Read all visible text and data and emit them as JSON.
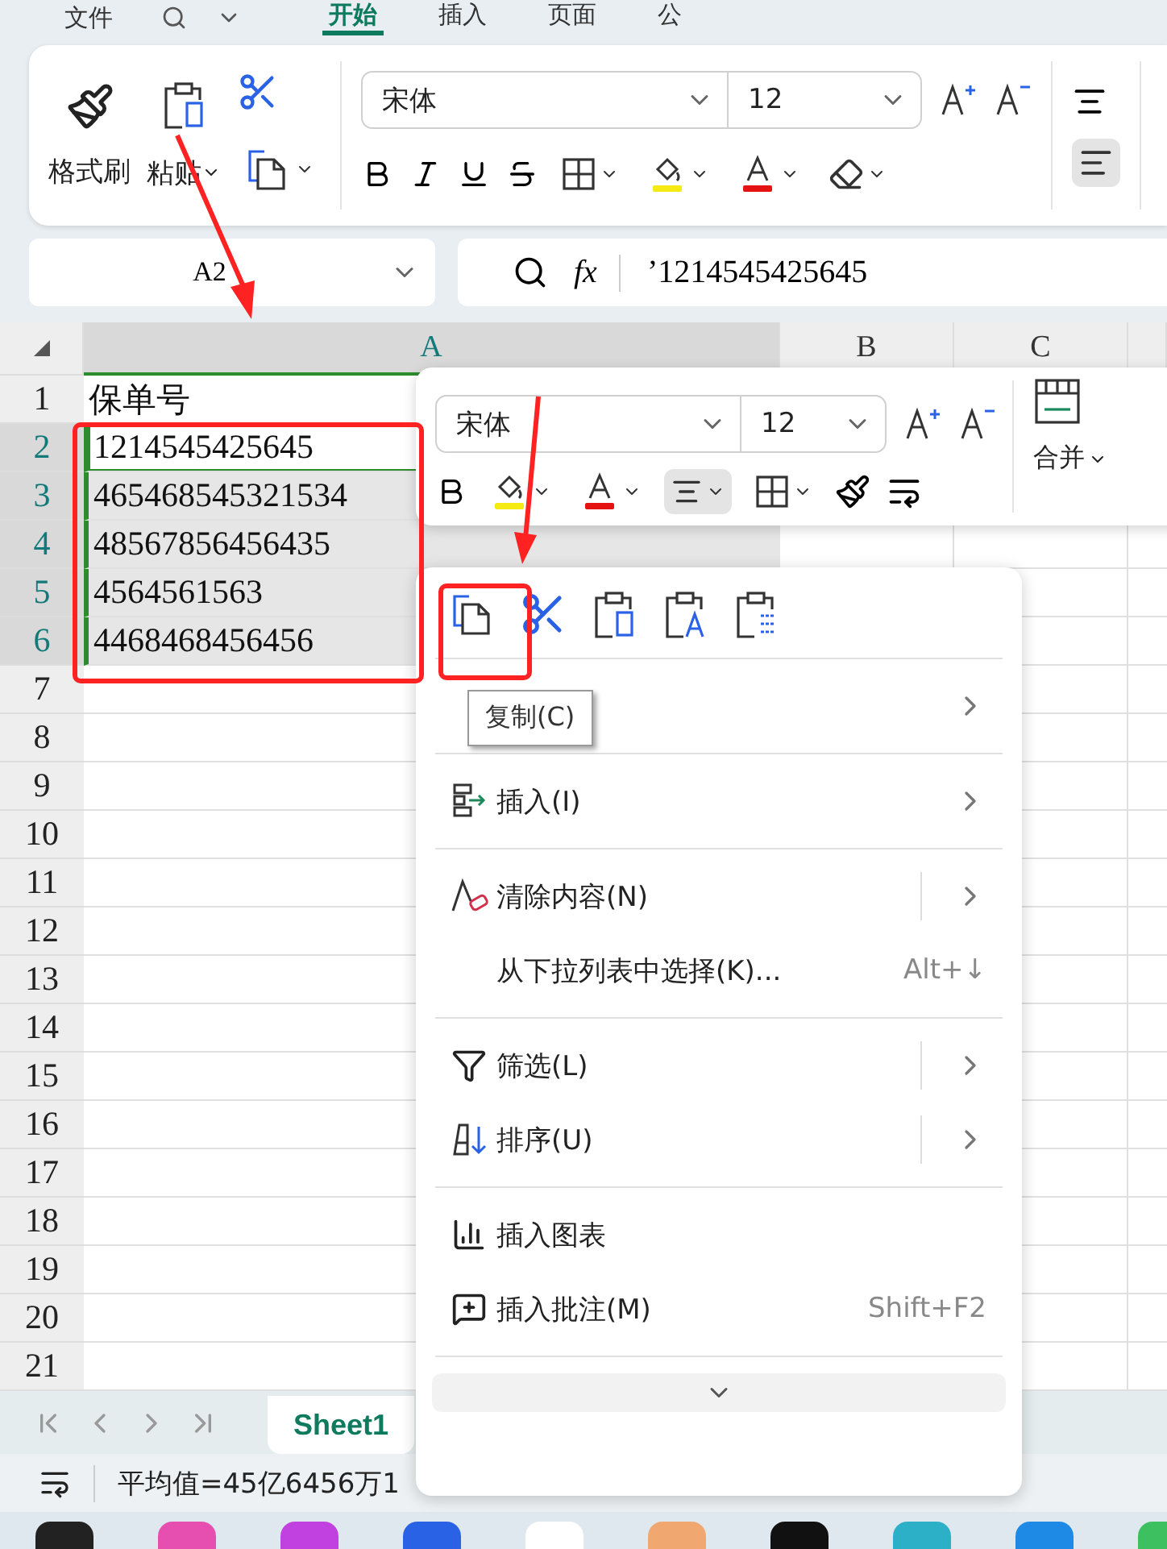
{
  "file_menu": "文件",
  "tabs": [
    {
      "label": "开始",
      "selected": true
    },
    {
      "label": "插入",
      "selected": false
    },
    {
      "label": "页面",
      "selected": false
    },
    {
      "label": "公",
      "selected": false
    }
  ],
  "ribbon": {
    "format_painter": "格式刷",
    "paste": "粘贴",
    "font": "宋体",
    "size": "12",
    "align_selected": true
  },
  "formula_bar": {
    "name_box": "A2",
    "fx": "fx",
    "value": "’1214545425645"
  },
  "sheet": {
    "columns": [
      {
        "label": "A",
        "selected": true
      },
      {
        "label": "B",
        "selected": false
      },
      {
        "label": "C",
        "selected": false
      }
    ],
    "rows": [
      {
        "number": "1",
        "value": "保单号",
        "selected": false,
        "active": false
      },
      {
        "number": "2",
        "value": "1214545425645",
        "selected": true,
        "active": true
      },
      {
        "number": "3",
        "value": "465468545321534",
        "selected": true,
        "active": false
      },
      {
        "number": "4",
        "value": "48567856456435",
        "selected": true,
        "active": false
      },
      {
        "number": "5",
        "value": "4564561563",
        "selected": true,
        "active": false
      },
      {
        "number": "6",
        "value": "4468468456456",
        "selected": true,
        "active": false
      },
      {
        "number": "7",
        "selected": false
      },
      {
        "number": "8",
        "selected": false
      },
      {
        "number": "9",
        "selected": false
      },
      {
        "number": "10",
        "selected": false
      },
      {
        "number": "11",
        "selected": false
      },
      {
        "number": "12",
        "selected": false
      },
      {
        "number": "13",
        "selected": false
      },
      {
        "number": "14",
        "selected": false
      },
      {
        "number": "15",
        "selected": false
      },
      {
        "number": "16",
        "selected": false
      },
      {
        "number": "17",
        "selected": false
      },
      {
        "number": "18",
        "selected": false
      },
      {
        "number": "19",
        "selected": false
      },
      {
        "number": "20",
        "selected": false
      },
      {
        "number": "21",
        "selected": false
      }
    ]
  },
  "mini_toolbar": {
    "font": "宋体",
    "size": "12",
    "merge": "合并",
    "align_selected": true
  },
  "context_menu": {
    "groups": [
      [
        {
          "submenu": true,
          "split": false
        }
      ],
      [
        {
          "label": "插入(I)",
          "submenu": true,
          "split": false
        }
      ],
      [
        {
          "label": "清除内容(N)",
          "submenu": true,
          "split": true
        },
        {
          "label": "从下拉列表中选择(K)...",
          "shortcut": "Alt+↓",
          "submenu": false,
          "split": false
        }
      ],
      [
        {
          "label": "筛选(L)",
          "submenu": true,
          "split": true
        },
        {
          "label": "排序(U)",
          "submenu": true,
          "split": true
        }
      ],
      [
        {
          "label": "插入图表",
          "submenu": false,
          "split": false
        },
        {
          "label": "插入批注(M)",
          "shortcut": "Shift+F2",
          "submenu": false,
          "split": false
        }
      ]
    ]
  },
  "tooltip": "复制(C)",
  "sheet_tabs": [
    {
      "label": "Sheet1",
      "selected": true
    }
  ],
  "status_bar": {
    "text": "平均值=45亿6456万1"
  }
}
